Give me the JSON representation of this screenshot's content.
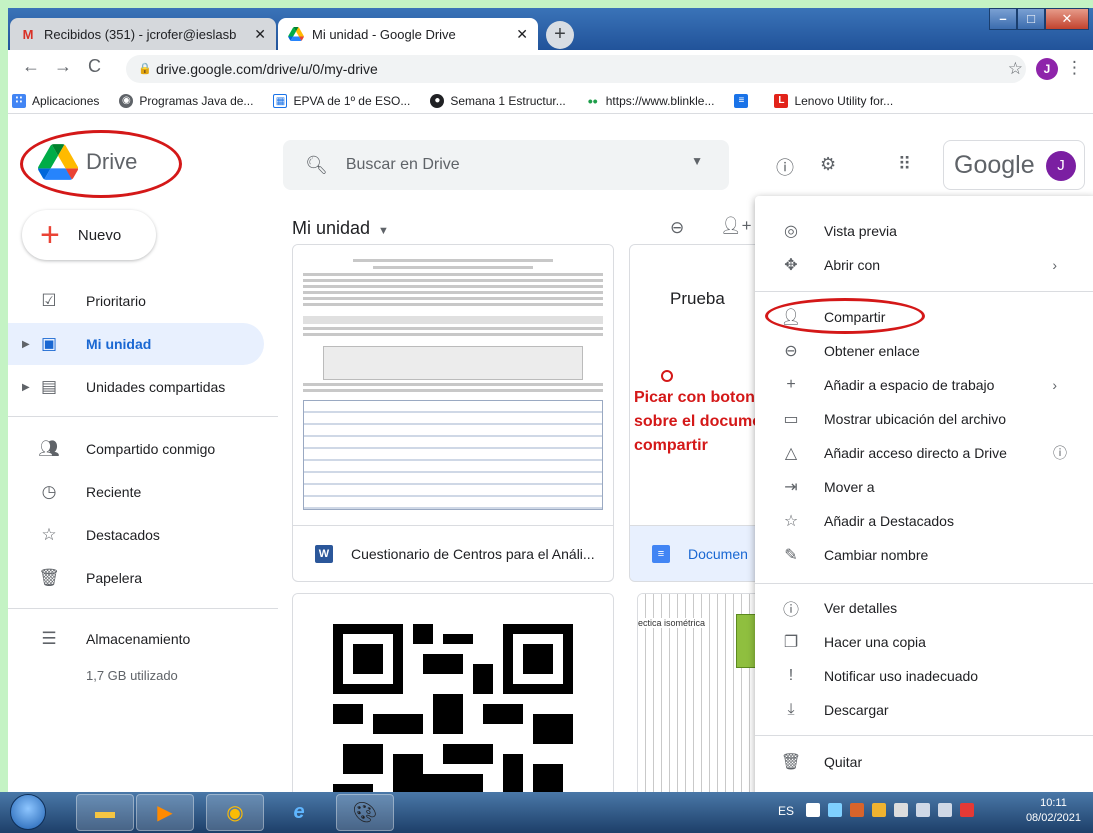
{
  "browser": {
    "tabs": [
      {
        "title": "Recibidos (351) - jcrofer@ieslasb",
        "icon": "gmail-icon"
      },
      {
        "title": "Mi unidad - Google Drive",
        "icon": "drive-icon"
      }
    ],
    "url": "drive.google.com/drive/u/0/my-drive",
    "profile_initial": "J",
    "bookmarks": [
      "Aplicaciones",
      "Programas Java de...",
      "EPVA de 1º de ESO...",
      "Semana 1 Estructur...",
      "https://www.blinkle...",
      "",
      "Lenovo Utility for..."
    ]
  },
  "drive": {
    "logo_text": "Drive",
    "search_placeholder": "Buscar en Drive",
    "google_text": "Google",
    "avatar_initial": "J",
    "new_button": "Nuevo",
    "sidebar": [
      {
        "label": "Prioritario",
        "icon": "check-square-icon"
      },
      {
        "label": "Mi unidad",
        "icon": "drive-folder-icon",
        "selected": true
      },
      {
        "label": "Unidades compartidas",
        "icon": "shared-drives-icon"
      },
      {
        "label": "Compartido conmigo",
        "icon": "people-icon"
      },
      {
        "label": "Reciente",
        "icon": "clock-icon"
      },
      {
        "label": "Destacados",
        "icon": "star-icon"
      },
      {
        "label": "Papelera",
        "icon": "trash-icon"
      },
      {
        "label": "Almacenamiento",
        "icon": "storage-icon"
      }
    ],
    "storage_used": "1,7 GB utilizado",
    "main_title": "Mi unidad",
    "files": [
      {
        "name": "Cuestionario de Centros para el Análi...",
        "type_letter": "W"
      },
      {
        "name": "Documen",
        "preview_text": "Prueba"
      },
      {
        "name": "",
        "preview": "qr-code"
      },
      {
        "name": "",
        "preview_text": "ectica isométrica"
      }
    ],
    "annotation": "Picar con boton derecho sobre el documento a compartir"
  },
  "context_menu": [
    {
      "label": "Vista previa",
      "icon": "eye-icon"
    },
    {
      "label": "Abrir con",
      "icon": "move-arrows-icon",
      "submenu": true
    },
    {
      "label": "Compartir",
      "icon": "person-add-icon"
    },
    {
      "label": "Obtener enlace",
      "icon": "link-icon"
    },
    {
      "label": "Añadir a espacio de trabajo",
      "icon": "plus-icon",
      "submenu": true
    },
    {
      "label": "Mostrar ubicación del archivo",
      "icon": "folder-icon"
    },
    {
      "label": "Añadir acceso directo a Drive",
      "icon": "shortcut-icon",
      "help": true
    },
    {
      "label": "Mover a",
      "icon": "move-to-folder-icon"
    },
    {
      "label": "Añadir a Destacados",
      "icon": "star-icon"
    },
    {
      "label": "Cambiar nombre",
      "icon": "pencil-icon"
    },
    {
      "label": "Ver detalles",
      "icon": "info-icon"
    },
    {
      "label": "Hacer una copia",
      "icon": "copy-icon"
    },
    {
      "label": "Notificar uso inadecuado",
      "icon": "report-icon"
    },
    {
      "label": "Descargar",
      "icon": "download-icon"
    },
    {
      "label": "Quitar",
      "icon": "trash-icon"
    }
  ],
  "taskbar": {
    "language": "ES",
    "time": "10:11",
    "date": "08/02/2021"
  },
  "colors": {
    "accent_blue": "#1967d2",
    "selected_bg": "#e8f0fe",
    "annotation_red": "#d41818",
    "avatar_purple": "#7b1fa2",
    "page_frame": "#c4f3c4"
  }
}
